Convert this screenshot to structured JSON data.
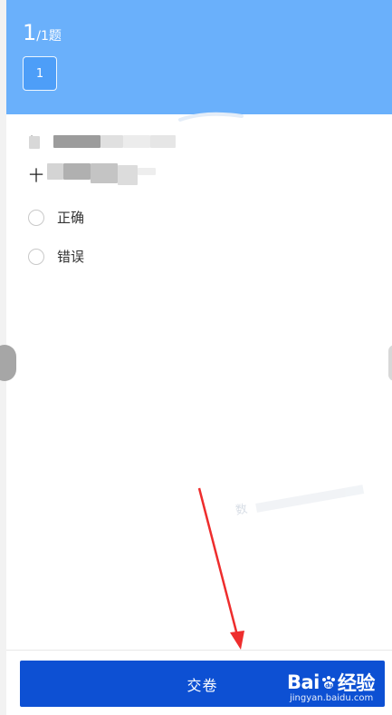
{
  "header": {
    "current_question": "1",
    "total_questions": "/1题",
    "nav_button_label": "1"
  },
  "question": {
    "line1_prefix": "‘",
    "line2_prefix": "十"
  },
  "options": [
    {
      "label": "正确"
    },
    {
      "label": "错误"
    }
  ],
  "submit": {
    "label": "交卷"
  },
  "watermark": {
    "brand_prefix": "Bai",
    "brand_suffix": "经验",
    "url": "jingyan.baidu.com",
    "faint_text": "数"
  },
  "colors": {
    "header_bg": "#6ab0fb",
    "submit_bg": "#0d50d3",
    "arrow": "#ee2d2d"
  }
}
